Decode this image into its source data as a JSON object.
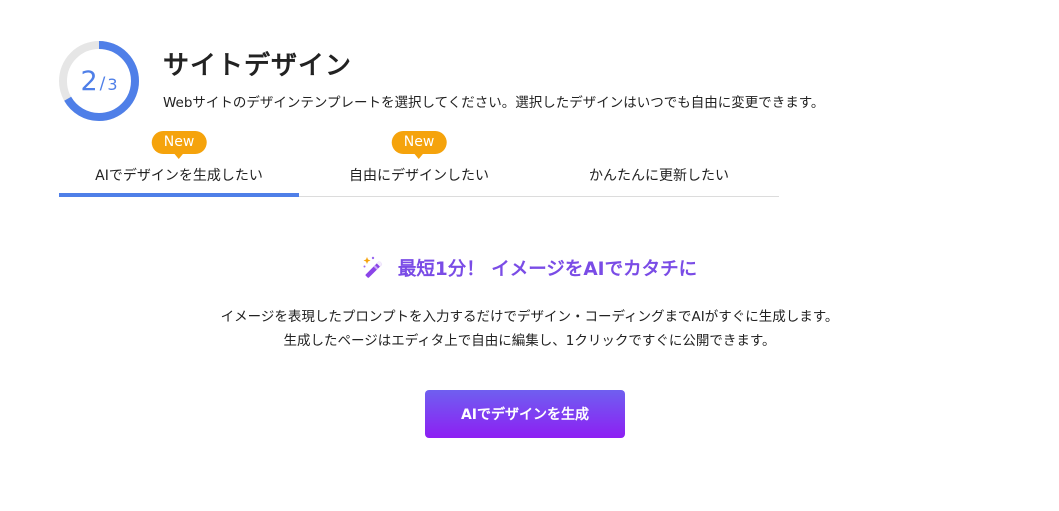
{
  "progress": {
    "current": "2",
    "separator": "/",
    "total": "3",
    "fraction": 0.6667,
    "color": "#4f7fe8",
    "track_color": "#e6e6e6"
  },
  "header": {
    "title": "サイトデザイン",
    "subtitle": "Webサイトのデザインテンプレートを選択してください。選択したデザインはいつでも自由に変更できます。"
  },
  "tabs": [
    {
      "label": "AIでデザインを生成したい",
      "badge": "New",
      "active": true
    },
    {
      "label": "自由にデザインしたい",
      "badge": "New",
      "active": false
    },
    {
      "label": "かんたんに更新したい",
      "badge": "",
      "active": false
    }
  ],
  "badge_color": "#f5a30c",
  "main": {
    "icon": "magic-wand-icon",
    "headline": "最短1分！ イメージをAIでカタチに",
    "headline_color": "#7a4ce6",
    "description_line1": "イメージを表現したプロンプトを入力するだけでデザイン・コーディングまでAIがすぐに生成します。",
    "description_line2": "生成したページはエディタ上で自由に編集し、1クリックですぐに公開できます。",
    "cta_label": "AIでデザインを生成"
  }
}
